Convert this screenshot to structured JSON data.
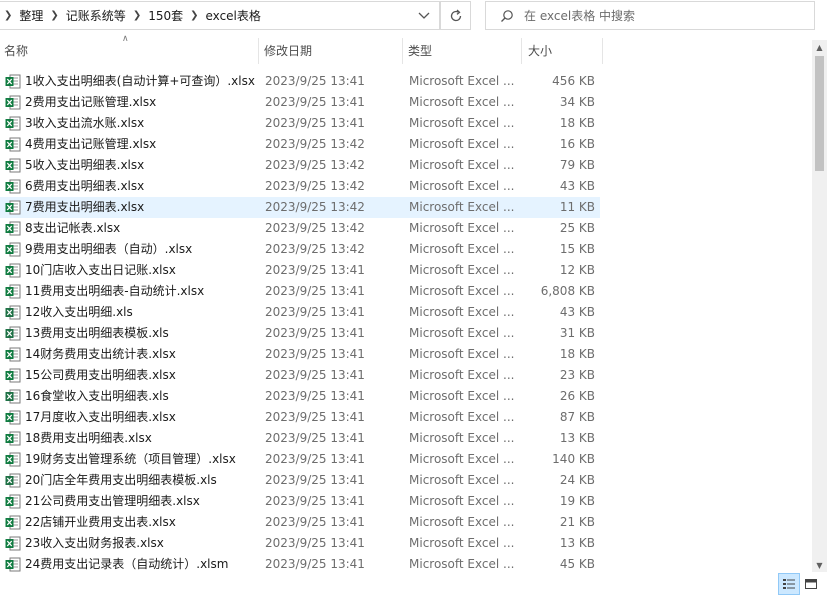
{
  "address_bar": {
    "crumbs": [
      "整理",
      "记账系统等",
      "150套",
      "excel表格"
    ]
  },
  "search": {
    "placeholder": "在 excel表格 中搜索"
  },
  "columns": {
    "name": "名称",
    "date": "修改日期",
    "type": "类型",
    "size": "大小"
  },
  "files": [
    {
      "name": "1收入支出明细表(自动计算+可查询）.xlsx",
      "date": "2023/9/25 13:41",
      "type": "Microsoft Excel ...",
      "size": "456 KB",
      "icon": "excel-xlsx-icon"
    },
    {
      "name": "2费用支出记账管理.xlsx",
      "date": "2023/9/25 13:41",
      "type": "Microsoft Excel ...",
      "size": "34 KB",
      "icon": "excel-xlsx-icon"
    },
    {
      "name": "3收入支出流水账.xlsx",
      "date": "2023/9/25 13:41",
      "type": "Microsoft Excel ...",
      "size": "18 KB",
      "icon": "excel-xlsx-icon"
    },
    {
      "name": "4费用支出记账管理.xlsx",
      "date": "2023/9/25 13:42",
      "type": "Microsoft Excel ...",
      "size": "16 KB",
      "icon": "excel-xlsx-icon"
    },
    {
      "name": "5收入支出明细表.xlsx",
      "date": "2023/9/25 13:42",
      "type": "Microsoft Excel ...",
      "size": "79 KB",
      "icon": "excel-xlsx-icon"
    },
    {
      "name": "6费用支出明细表.xlsx",
      "date": "2023/9/25 13:42",
      "type": "Microsoft Excel ...",
      "size": "43 KB",
      "icon": "excel-xlsx-icon"
    },
    {
      "name": "7费用支出明细表.xlsx",
      "date": "2023/9/25 13:42",
      "type": "Microsoft Excel ...",
      "size": "11 KB",
      "icon": "excel-xlsx-icon",
      "selected": true
    },
    {
      "name": "8支出记帐表.xlsx",
      "date": "2023/9/25 13:42",
      "type": "Microsoft Excel ...",
      "size": "25 KB",
      "icon": "excel-xlsx-icon"
    },
    {
      "name": "9费用支出明细表（自动）.xlsx",
      "date": "2023/9/25 13:42",
      "type": "Microsoft Excel ...",
      "size": "15 KB",
      "icon": "excel-xlsx-icon"
    },
    {
      "name": "10门店收入支出日记账.xlsx",
      "date": "2023/9/25 13:41",
      "type": "Microsoft Excel ...",
      "size": "12 KB",
      "icon": "excel-xlsx-icon"
    },
    {
      "name": "11费用支出明细表-自动统计.xlsx",
      "date": "2023/9/25 13:41",
      "type": "Microsoft Excel ...",
      "size": "6,808 KB",
      "icon": "excel-xlsx-icon"
    },
    {
      "name": "12收入支出明细.xls",
      "date": "2023/9/25 13:41",
      "type": "Microsoft Excel ...",
      "size": "43 KB",
      "icon": "excel-xls-icon"
    },
    {
      "name": "13费用支出明细表模板.xls",
      "date": "2023/9/25 13:41",
      "type": "Microsoft Excel ...",
      "size": "31 KB",
      "icon": "excel-xls-icon"
    },
    {
      "name": "14财务费用支出统计表.xlsx",
      "date": "2023/9/25 13:41",
      "type": "Microsoft Excel ...",
      "size": "18 KB",
      "icon": "excel-xlsx-icon"
    },
    {
      "name": "15公司费用支出明细表.xlsx",
      "date": "2023/9/25 13:41",
      "type": "Microsoft Excel ...",
      "size": "23 KB",
      "icon": "excel-xlsx-icon"
    },
    {
      "name": "16食堂收入支出明细表.xls",
      "date": "2023/9/25 13:41",
      "type": "Microsoft Excel ...",
      "size": "26 KB",
      "icon": "excel-xls-icon"
    },
    {
      "name": "17月度收入支出明细表.xlsx",
      "date": "2023/9/25 13:41",
      "type": "Microsoft Excel ...",
      "size": "87 KB",
      "icon": "excel-xlsx-icon"
    },
    {
      "name": "18费用支出明细表.xlsx",
      "date": "2023/9/25 13:41",
      "type": "Microsoft Excel ...",
      "size": "13 KB",
      "icon": "excel-xlsx-icon"
    },
    {
      "name": "19财务支出管理系统（项目管理）.xlsx",
      "date": "2023/9/25 13:41",
      "type": "Microsoft Excel ...",
      "size": "140 KB",
      "icon": "excel-xlsx-icon"
    },
    {
      "name": "20门店全年费用支出明细表模板.xls",
      "date": "2023/9/25 13:41",
      "type": "Microsoft Excel ...",
      "size": "24 KB",
      "icon": "excel-xls-icon"
    },
    {
      "name": "21公司费用支出管理明细表.xlsx",
      "date": "2023/9/25 13:41",
      "type": "Microsoft Excel ...",
      "size": "19 KB",
      "icon": "excel-xlsx-icon"
    },
    {
      "name": "22店铺开业费用支出表.xlsx",
      "date": "2023/9/25 13:41",
      "type": "Microsoft Excel ...",
      "size": "21 KB",
      "icon": "excel-xlsx-icon"
    },
    {
      "name": "23收入支出财务报表.xlsx",
      "date": "2023/9/25 13:41",
      "type": "Microsoft Excel ...",
      "size": "13 KB",
      "icon": "excel-xlsx-icon"
    },
    {
      "name": "24费用支出记录表（自动统计）.xlsm",
      "date": "2023/9/25 13:41",
      "type": "Microsoft Excel ...",
      "size": "45 KB",
      "icon": "excel-xlsm-icon"
    }
  ],
  "view_buttons": [
    {
      "icon": "details-view-icon",
      "active": true
    },
    {
      "icon": "large-icons-view-icon",
      "active": false
    }
  ]
}
